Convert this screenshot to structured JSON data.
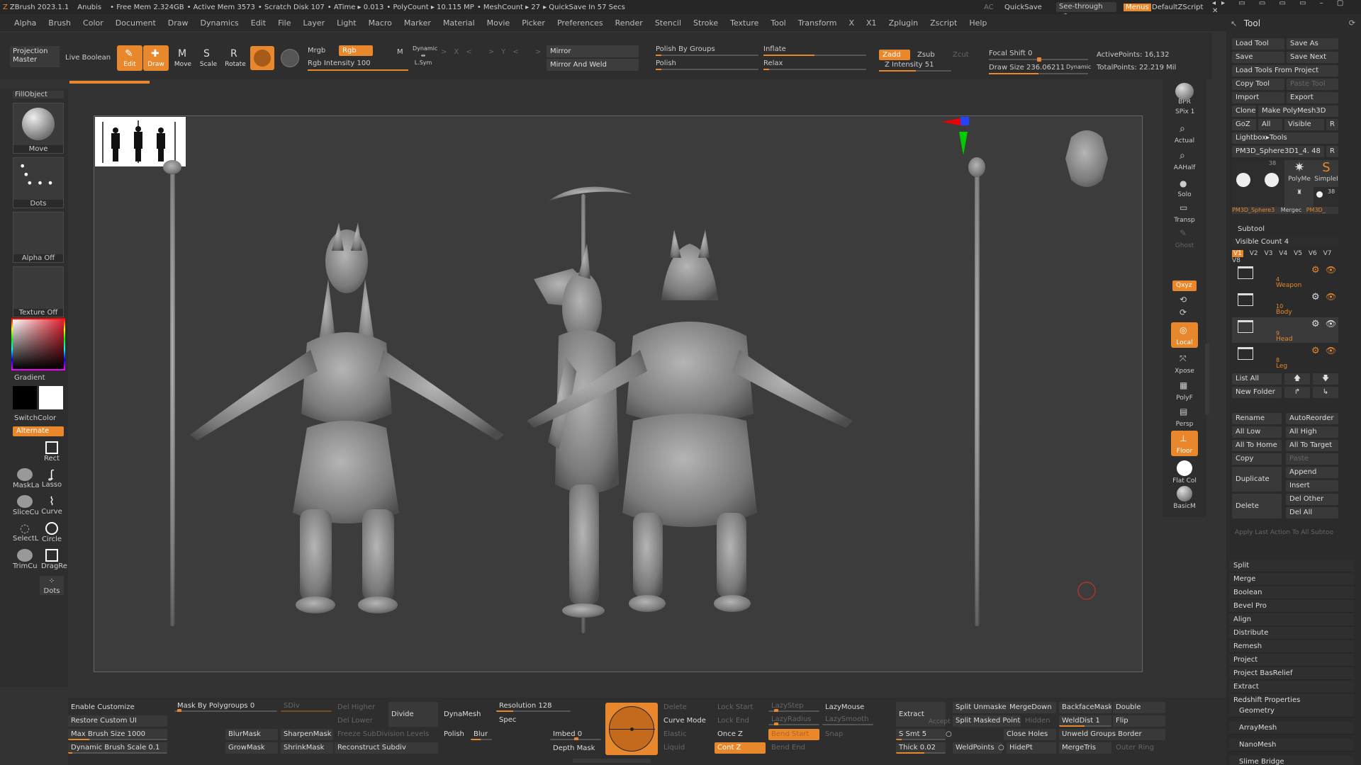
{
  "titlebar": {
    "app": "ZBrush 2023.1.1",
    "doc": "Anubis",
    "free_mem": "• Free Mem 2.324GB",
    "active_mem": "• Active Mem 3573",
    "scratch": "• Scratch Disk 107",
    "atime": "• ATime ▸ 0.013",
    "polycount": "• PolyCount ▸ 10.115 MP",
    "meshcount": "• MeshCount ▸ 27",
    "quicksave_in": "▸ QuickSave In 57 Secs",
    "ac": "AC",
    "quicksave": "QuickSave",
    "see_through": "See-through",
    "see_through_val": "0",
    "menus": "Menus",
    "zscript": "DefaultZScript"
  },
  "menubar": [
    "Alpha",
    "Brush",
    "Color",
    "Document",
    "Draw",
    "Dynamics",
    "Edit",
    "File",
    "Layer",
    "Light",
    "Macro",
    "Marker",
    "Material",
    "Movie",
    "Picker",
    "Preferences",
    "Render",
    "Stencil",
    "Stroke",
    "Texture",
    "Tool",
    "Transform",
    "X",
    "X1",
    "Zplugin",
    "Zscript",
    "Help"
  ],
  "toolbar": {
    "projection_master": "Projection Master",
    "live_boolean": "Live Boolean",
    "edit": "Edit",
    "draw": "Draw",
    "move": "Move",
    "scale": "Scale",
    "rotate": "Rotate",
    "mrgb": "Mrgb",
    "rgb": "Rgb",
    "m": "M",
    "rgb_intensity": "Rgb Intensity 100",
    "dynamic": "Dynamic",
    "lsym": "L.Sym",
    "mirror": "Mirror",
    "mirror_and_weld": "Mirror And Weld",
    "polish_by_groups": "Polish By Groups",
    "polish": "Polish",
    "inflate": "Inflate",
    "relax": "Relax",
    "zadd": "Zadd",
    "zsub": "Zsub",
    "zcut": "Zcut",
    "z_intensity": "Z Intensity 51",
    "focal_shift": "Focal Shift 0",
    "draw_size": "Draw Size 236.06211",
    "dynamic2": "Dynamic",
    "active_points": "ActivePoints: 16,132",
    "total_points": "TotalPoints: 22.219 Mil"
  },
  "left": {
    "fillobject": "FillObject",
    "move": "Move",
    "dots": "Dots",
    "alpha_off": "Alpha Off",
    "texture_off": "Texture Off",
    "gradient": "Gradient",
    "switchcolor": "SwitchColor",
    "alternate": "Alternate",
    "rect": "Rect",
    "maskla": "MaskLa",
    "lasso": "Lasso",
    "slicecu": "SliceCu",
    "curve": "Curve",
    "selectl": "SelectL",
    "circle": "Circle",
    "trimcu": "TrimCu",
    "dragre": "DragRe",
    "dots2": "Dots"
  },
  "rightstrip": [
    "BPR",
    "SPix 1",
    "Actual",
    "AAHalf",
    "Solo",
    "Transp",
    "Ghost",
    "Local",
    "Xpose",
    "PolyF",
    "Persp",
    "Floor",
    "Flat Col",
    "BasicM"
  ],
  "rightstrip_xyz": "Qxyz",
  "toolpanel": {
    "title": "Tool",
    "load_tool": "Load Tool",
    "save_as": "Save As",
    "save": "Save",
    "save_next": "Save Next",
    "load_from_project": "Load Tools From Project",
    "copy_tool": "Copy Tool",
    "paste_tool": "Paste Tool",
    "import": "Import",
    "export": "Export",
    "clone": "Clone",
    "make_polymesh": "Make PolyMesh3D",
    "goz": "GoZ",
    "all": "All",
    "visible": "Visible",
    "r": "R",
    "lightbox_tools": "Lightbox▸Tools",
    "current_tool": "PM3D_Sphere3D1_4. 48",
    "thumb_labels": [
      "PM3D_Sphere3",
      "Mergec",
      "PM3D_"
    ],
    "polyme": "PolyMe",
    "simple": "SimpleI",
    "subtool": "Subtool",
    "visible_count": "Visible Count 4",
    "versions": [
      "V1",
      "V2",
      "V3",
      "V4",
      "V5",
      "V6",
      "V7",
      "V8"
    ],
    "subtools": [
      {
        "count": "4",
        "name": "Weapon"
      },
      {
        "count": "10",
        "name": "Body"
      },
      {
        "count": "9",
        "name": "Head"
      },
      {
        "count": "8",
        "name": "Leg"
      }
    ],
    "list_all": "List All",
    "new_folder": "New Folder",
    "rename": "Rename",
    "autoreorder": "AutoReorder",
    "all_low": "All Low",
    "all_high": "All High",
    "all_to_home": "All To Home",
    "all_to_target": "All To Target",
    "copy": "Copy",
    "paste": "Paste",
    "duplicate": "Duplicate",
    "append": "Append",
    "insert": "Insert",
    "delete": "Delete",
    "del_other": "Del Other",
    "del_all": "Del All",
    "apply_last": "Apply Last Action To All Subtoo",
    "sections": [
      "Split",
      "Merge",
      "Boolean",
      "Bevel Pro",
      "Align",
      "Distribute",
      "Remesh",
      "Project",
      "Project BasRelief",
      "Extract",
      "Redshift Properties"
    ],
    "sections2": [
      "Geometry",
      "ArrayMesh",
      "NanoMesh",
      "Slime Bridge"
    ]
  },
  "bottom": {
    "enable_customize": "Enable Customize",
    "restore_custom_ui": "Restore Custom UI",
    "max_brush_size": "Max Brush Size 1000",
    "dynamic_brush_scale": "Dynamic Brush Scale 0.1",
    "mask_by_polygroups": "Mask By Polygroups 0",
    "sdiv": "SDiv",
    "del_higher": "Del Higher",
    "del_lower": "Del Lower",
    "divide": "Divide",
    "dynamesh": "DynaMesh",
    "resolution": "Resolution 128",
    "spec": "Spec",
    "polish": "Polish",
    "blur": "Blur",
    "blurmask": "BlurMask",
    "sharpenmask": "SharpenMask",
    "freeze_subdiv": "Freeze SubDivision Levels",
    "growmask": "GrowMask",
    "shrinkmask": "ShrinkMask",
    "reconstruct_subdiv": "Reconstruct Subdiv",
    "imbed": "Imbed 0",
    "depth_mask": "Depth Mask",
    "delete": "Delete",
    "curve_mode": "Curve Mode",
    "elastic": "Elastic",
    "liquid": "Liquid",
    "lock_start": "Lock Start",
    "lock_end": "Lock End",
    "once_z": "Once Z",
    "cont_z": "Cont Z",
    "lazystep": "LazyStep",
    "lazyradius": "LazyRadius",
    "bend_start": "Bend Start",
    "bend_end": "Bend End",
    "lazymouse": "LazyMouse",
    "lazysmooth": "LazySmooth",
    "snap": "Snap",
    "extract": "Extract",
    "accept": "Accept",
    "s_smt": "S Smt 5",
    "thick": "Thick 0.02",
    "split_unmasked": "Split Unmasked",
    "mergedown": "MergeDown",
    "split_masked": "Split Masked Points",
    "hidden": "Hidden",
    "close_holes": "Close Holes",
    "weldpoints": "WeldPoints",
    "hidept": "HidePt",
    "backfacemask": "BackfaceMask",
    "double": "Double",
    "weld_dist": "WeldDist 1",
    "flip": "Flip",
    "unweld_groups_border": "Unweld Groups Border",
    "mergetris": "MergeTris",
    "outer_ring": "Outer Ring"
  },
  "colors": {
    "accent": "#e8872b",
    "bg": "#333333",
    "canvas": "#3c3c3c"
  }
}
